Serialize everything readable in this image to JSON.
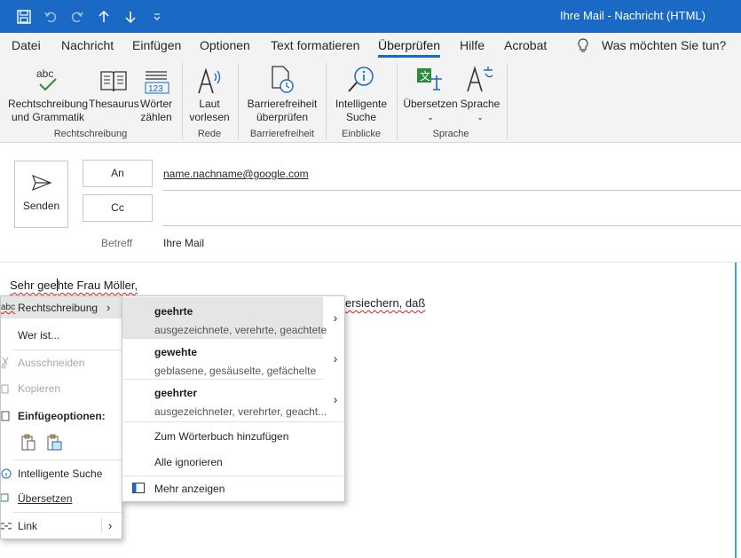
{
  "titlebar": {
    "title": "Ihre Mail  -  Nachricht (HTML)",
    "icons": [
      "save-icon",
      "undo-icon",
      "redo-icon",
      "arrow-up-icon",
      "arrow-down-icon",
      "customize-qat-icon"
    ]
  },
  "menu": {
    "tabs": [
      "Datei",
      "Nachricht",
      "Einfügen",
      "Optionen",
      "Text formatieren",
      "Überprüfen",
      "Hilfe",
      "Acrobat"
    ],
    "active": "Überprüfen",
    "search": "Was möchten Sie tun?"
  },
  "ribbon": {
    "spelling": {
      "line1": "Rechtschreibung",
      "line2": "und Grammatik",
      "icon_text": "abc"
    },
    "thesaurus": "Thesaurus",
    "wordcount": {
      "line1": "Wörter",
      "line2": "zählen",
      "icon_text": "123"
    },
    "readaloud": {
      "line1": "Laut",
      "line2": "vorlesen"
    },
    "accessibility": {
      "line1": "Barrierefreiheit",
      "line2": "überprüfen"
    },
    "smartlookup": {
      "line1": "Intelligente",
      "line2": "Suche"
    },
    "translate": "Übersetzen",
    "language": "Sprache",
    "groups": [
      "Rechtschreibung",
      "Rede",
      "Barrierefreiheit",
      "Einblicke",
      "Sprache"
    ]
  },
  "compose": {
    "send": "Senden",
    "to_label": "An",
    "to_value": "name.nachname@google.com",
    "cc_label": "Cc",
    "subject_label": "Betreff",
    "subject_value": "Ihre Mail"
  },
  "body": {
    "line1_a": "Sehr gee",
    "line1_b": "hte Frau Möller,",
    "line2": "ersiechern, daß"
  },
  "context_menu": {
    "spelling": "Rechtschreibung",
    "whois": "Wer ist...",
    "cut": "Ausschneiden",
    "copy": "Kopieren",
    "paste_options": "Einfügeoptionen:",
    "smart_lookup": "Intelligente Suche",
    "translate": "Übersetzen",
    "link": "Link"
  },
  "submenu": {
    "suggestions": [
      {
        "word": "geehrte",
        "synonyms": "ausgezeichnete, verehrte, geachtete"
      },
      {
        "word": "gewehte",
        "synonyms": "geblasene, gesäuselte, gefächelte"
      },
      {
        "word": "geehrter",
        "synonyms": "ausgezeichneter, verehrter, geacht..."
      }
    ],
    "add_to_dictionary": "Zum Wörterbuch hinzufügen",
    "ignore_all": "Alle ignorieren",
    "see_more": "Mehr anzeigen"
  },
  "colors": {
    "titlebar": "#1a69c4",
    "ribbon": "#f3f3f3",
    "accent": "#1a69c4",
    "highlight": "#e5e5e5",
    "squiggle": "#d92020"
  }
}
